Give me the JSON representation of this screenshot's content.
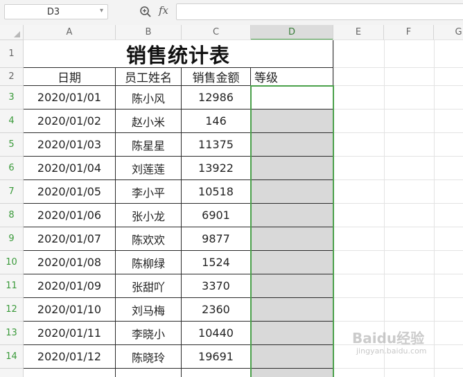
{
  "formula_bar": {
    "name_box": "D3",
    "fx_label": "fx",
    "formula": ""
  },
  "columns": [
    "A",
    "B",
    "C",
    "D",
    "E",
    "F",
    "G"
  ],
  "row_numbers": [
    "1",
    "2",
    "3",
    "4",
    "5",
    "6",
    "7",
    "8",
    "9",
    "10",
    "11",
    "12",
    "13",
    "14"
  ],
  "sheet": {
    "title": "销售统计表",
    "headers": {
      "date": "日期",
      "name": "员工姓名",
      "amount": "销售金额",
      "grade": "等级"
    },
    "rows": [
      {
        "date": "2020/01/01",
        "name": "陈小风",
        "amount": "12986",
        "grade": ""
      },
      {
        "date": "2020/01/02",
        "name": "赵小米",
        "amount": "146",
        "grade": ""
      },
      {
        "date": "2020/01/03",
        "name": "陈星星",
        "amount": "11375",
        "grade": ""
      },
      {
        "date": "2020/01/04",
        "name": "刘莲莲",
        "amount": "13922",
        "grade": ""
      },
      {
        "date": "2020/01/05",
        "name": "李小平",
        "amount": "10518",
        "grade": ""
      },
      {
        "date": "2020/01/06",
        "name": "张小龙",
        "amount": "6901",
        "grade": ""
      },
      {
        "date": "2020/01/07",
        "name": "陈欢欢",
        "amount": "9877",
        "grade": ""
      },
      {
        "date": "2020/01/08",
        "name": "陈柳绿",
        "amount": "1524",
        "grade": ""
      },
      {
        "date": "2020/01/09",
        "name": "张甜吖",
        "amount": "3370",
        "grade": ""
      },
      {
        "date": "2020/01/10",
        "name": "刘马梅",
        "amount": "2360",
        "grade": ""
      },
      {
        "date": "2020/01/11",
        "name": "李晓小",
        "amount": "10440",
        "grade": ""
      },
      {
        "date": "2020/01/12",
        "name": "陈晓玲",
        "amount": "19691",
        "grade": ""
      }
    ]
  },
  "colors": {
    "selection": "#4aa04a",
    "grade_fill": "#d9d9d9",
    "border": "#2a2a2a"
  },
  "watermark": {
    "brand": "Baidu经验",
    "url": "jingyan.baidu.com"
  }
}
